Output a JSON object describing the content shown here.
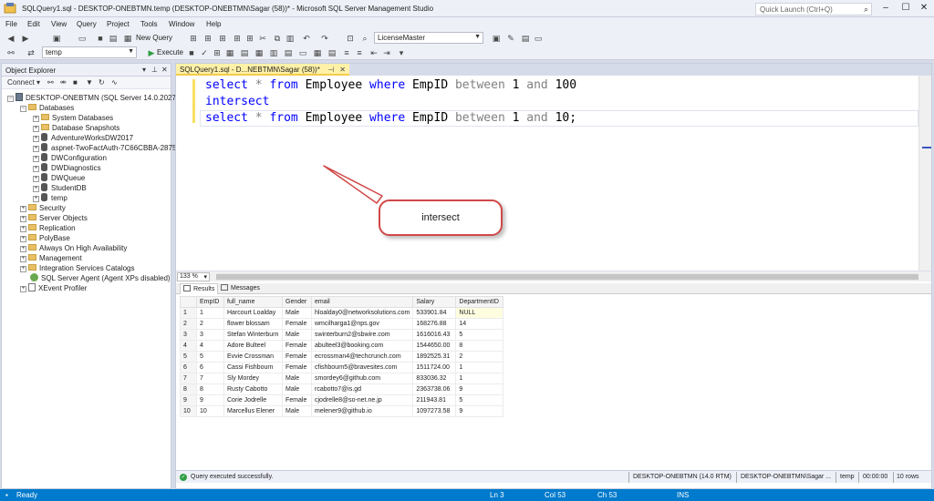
{
  "window": {
    "title": "SQLQuery1.sql - DESKTOP-ONEBTMN.temp (DESKTOP-ONEBTMN\\Sagar (58))* - Microsoft SQL Server Management Studio",
    "quick_launch_placeholder": "Quick Launch (Ctrl+Q)"
  },
  "menu": [
    "File",
    "Edit",
    "View",
    "Query",
    "Project",
    "Tools",
    "Window",
    "Help"
  ],
  "toolbar": {
    "new_query": "New Query",
    "connection_combo": "LicenseMaster",
    "database_combo": "temp",
    "execute": "Execute"
  },
  "object_explorer": {
    "title": "Object Explorer",
    "connect": "Connect",
    "server": "DESKTOP-ONEBTMN (SQL Server 14.0.2027.2",
    "nodes": [
      {
        "label": "Databases"
      },
      {
        "label": "System Databases"
      },
      {
        "label": "Database Snapshots"
      },
      {
        "label": "AdventureWorksDW2017"
      },
      {
        "label": "aspnet-TwoFactAuth-7C66CBBA-2875"
      },
      {
        "label": "DWConfiguration"
      },
      {
        "label": "DWDiagnostics"
      },
      {
        "label": "DWQueue"
      },
      {
        "label": "StudentDB"
      },
      {
        "label": "temp"
      },
      {
        "label": "Security"
      },
      {
        "label": "Server Objects"
      },
      {
        "label": "Replication"
      },
      {
        "label": "PolyBase"
      },
      {
        "label": "Always On High Availability"
      },
      {
        "label": "Management"
      },
      {
        "label": "Integration Services Catalogs"
      },
      {
        "label": "SQL Server Agent (Agent XPs disabled)"
      },
      {
        "label": "XEvent Profiler"
      }
    ]
  },
  "editor": {
    "tab_label": "SQLQuery1.sql - D...NEBTMN\\Sagar (58))*",
    "line1": {
      "select": "select",
      "star": "*",
      "from": "from",
      "table": "Employee",
      "where": "where",
      "col": "EmpID",
      "between": "between",
      "a": "1",
      "and": "and",
      "b": "100"
    },
    "line2": {
      "intersect": "intersect"
    },
    "line3": {
      "select": "select",
      "star": "*",
      "from": "from",
      "table": "Employee",
      "where": "where",
      "col": "EmpID",
      "between": "between",
      "a": "1",
      "and": "and",
      "b": "10;"
    },
    "callout": "intersect",
    "zoom": "133 %"
  },
  "results": {
    "tab_results": "Results",
    "tab_messages": "Messages",
    "columns": [
      "EmpID",
      "full_name",
      "Gender",
      "email",
      "Salary",
      "DepartmentID"
    ],
    "rows": [
      [
        "1",
        "1",
        "Harcourt Loalday",
        "Male",
        "hloalday0@networksolutions.com",
        "533901.84",
        "NULL"
      ],
      [
        "2",
        "2",
        "flower blossam",
        "Female",
        "wmcilharga1@nps.gov",
        "168276.88",
        "14"
      ],
      [
        "3",
        "3",
        "Stefan Winterburn",
        "Male",
        "swinterburn2@sbwire.com",
        "1616016.43",
        "5"
      ],
      [
        "4",
        "4",
        "Adore Bulteel",
        "Female",
        "abulteel3@booking.com",
        "1544650.00",
        "8"
      ],
      [
        "5",
        "5",
        "Evvie Crossman",
        "Female",
        "ecrossman4@techcrunch.com",
        "1892525.31",
        "2"
      ],
      [
        "6",
        "6",
        "Cassi Fishbourn",
        "Female",
        "cfishbourn5@bravesites.com",
        "1511724.00",
        "1"
      ],
      [
        "7",
        "7",
        "Sly Mordey",
        "Male",
        "smordey6@github.com",
        "833036.32",
        "1"
      ],
      [
        "8",
        "8",
        "Rusty Cabotto",
        "Male",
        "rcabotto7@is.gd",
        "2363738.06",
        "9"
      ],
      [
        "9",
        "9",
        "Corie Jodrelle",
        "Female",
        "cjodrelle8@so-net.ne.jp",
        "211943.81",
        "5"
      ],
      [
        "10",
        "10",
        "Marcellus Elener",
        "Male",
        "melener9@github.io",
        "1097273.58",
        "9"
      ]
    ]
  },
  "query_status": {
    "message": "Query executed successfully.",
    "server": "DESKTOP-ONEBTMN (14.0 RTM)",
    "user": "DESKTOP-ONEBTMN\\Sagar ...",
    "database": "temp",
    "elapsed": "00:00:00",
    "rows": "10 rows"
  },
  "statusbar": {
    "ready": "Ready",
    "ln": "Ln 3",
    "col": "Col 53",
    "ch": "Ch 53",
    "mode": "INS"
  },
  "colors": {
    "accent": "#007acc",
    "keyword": "#0000ff",
    "callout_border": "#d04848",
    "tab_active": "#fff1a8"
  }
}
